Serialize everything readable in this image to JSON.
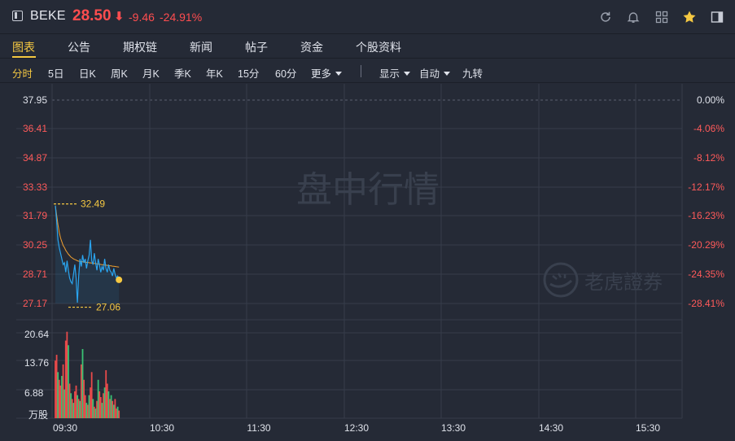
{
  "header": {
    "ticker": "BEKE",
    "price": "28.50",
    "arrow": "⬇",
    "change": "-9.46",
    "change_pct": "-24.91%"
  },
  "tabs": [
    "图表",
    "公告",
    "期权链",
    "新闻",
    "帖子",
    "资金",
    "个股资料"
  ],
  "active_tab": 0,
  "toolbar": {
    "periods": [
      "分时",
      "5日",
      "日K",
      "周K",
      "月K",
      "季K",
      "年K",
      "15分",
      "60分",
      "更多"
    ],
    "active_period": 0,
    "display": "显示",
    "auto": "自动",
    "adjust": "九转"
  },
  "chart_data": {
    "type": "line",
    "price_axis": [
      "37.95",
      "36.41",
      "34.87",
      "33.33",
      "31.79",
      "30.25",
      "28.71",
      "27.17"
    ],
    "pct_axis": [
      "0.00%",
      "-4.06%",
      "-8.12%",
      "-12.17%",
      "-16.23%",
      "-20.29%",
      "-24.35%",
      "-28.41%"
    ],
    "volume_axis": [
      "20.64",
      "13.76",
      "6.88"
    ],
    "volume_unit": "万股",
    "time_axis": [
      "09:30",
      "10:30",
      "11:30",
      "12:30",
      "13:30",
      "14:30",
      "15:30"
    ],
    "prev_close": 37.95,
    "ylim": [
      26.4,
      37.95
    ],
    "high_label": "32.49",
    "low_label": "27.06",
    "high": 32.49,
    "low": 27.06,
    "last": 28.5,
    "watermark_center": "盘中行情",
    "watermark_brand": "老虎證券",
    "colors": {
      "price_line": "#2aa5f0",
      "avg_line": "#f0a030",
      "up": "#e84a4a",
      "down": "#39c274",
      "marker": "#f5c842"
    },
    "price_series": [
      32.4,
      31.6,
      30.6,
      30.2,
      29.9,
      29.6,
      29.3,
      29.4,
      28.9,
      29.5,
      29.0,
      28.6,
      28.4,
      28.3,
      28.8,
      29.3,
      28.6,
      27.3,
      28.7,
      29.6,
      29.2,
      29.8,
      29.4,
      29.6,
      29.1,
      29.5,
      29.8,
      30.6,
      29.5,
      29.3,
      29.9,
      29.4,
      29.0,
      29.6,
      29.3,
      28.9,
      29.2,
      29.0,
      29.6,
      29.1,
      28.9,
      29.3,
      29.0,
      28.9,
      28.7,
      29.1,
      28.8,
      28.6,
      28.7,
      28.5
    ],
    "avg_series": [
      32.4,
      31.9,
      31.4,
      31.0,
      30.7,
      30.5,
      30.3,
      30.2,
      30.05,
      29.95,
      29.85,
      29.78,
      29.7,
      29.65,
      29.6,
      29.57,
      29.54,
      29.5,
      29.48,
      29.47,
      29.46,
      29.45,
      29.44,
      29.43,
      29.42,
      29.41,
      29.4,
      29.39,
      29.38,
      29.37,
      29.36,
      29.35,
      29.34,
      29.33,
      29.32,
      29.31,
      29.3,
      29.29,
      29.28,
      29.27,
      29.26,
      29.25,
      29.24,
      29.23,
      29.22,
      29.21,
      29.2,
      29.19,
      29.18,
      29.17
    ],
    "volume_max": 23.5,
    "volume_series": [
      15.0,
      16.5,
      12.0,
      10.0,
      8.5,
      11.0,
      14.0,
      7.5,
      20.2,
      22.5,
      19.0,
      9.0,
      6.5,
      5.0,
      4.0,
      7.0,
      8.5,
      6.0,
      5.0,
      4.5,
      14.0,
      18.0,
      10.0,
      6.0,
      4.0,
      3.5,
      6.0,
      8.0,
      12.0,
      5.0,
      3.0,
      2.5,
      4.5,
      10.0,
      7.0,
      5.5,
      4.0,
      6.5,
      8.0,
      12.5,
      9.0,
      7.0,
      5.0,
      6.0,
      4.5,
      3.5,
      5.0,
      2.5,
      3.0,
      2.0
    ],
    "volume_up": [
      1,
      1,
      0,
      1,
      1,
      0,
      1,
      0,
      1,
      1,
      0,
      1,
      0,
      1,
      0,
      1,
      1,
      0,
      1,
      0,
      1,
      0,
      1,
      1,
      0,
      1,
      0,
      1,
      1,
      0,
      1,
      0,
      1,
      0,
      1,
      1,
      0,
      1,
      0,
      1,
      1,
      0,
      1,
      0,
      1,
      0,
      1,
      1,
      0,
      1
    ]
  }
}
